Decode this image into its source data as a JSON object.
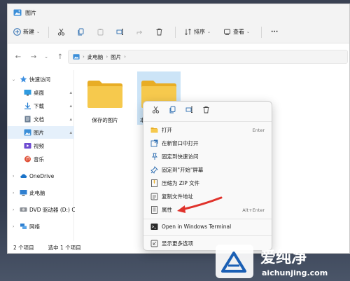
{
  "window": {
    "title": "图片"
  },
  "toolbar": {
    "new_label": "新建",
    "sort_label": "排序",
    "view_label": "查看",
    "more_label": "···"
  },
  "address": {
    "segments": [
      "此电脑",
      "图片"
    ]
  },
  "nav": {
    "items": [
      {
        "label": "快速访问",
        "icon": "star-icon"
      },
      {
        "label": "桌面",
        "icon": "desktop-icon"
      },
      {
        "label": "下载",
        "icon": "download-icon"
      },
      {
        "label": "文档",
        "icon": "document-icon"
      },
      {
        "label": "图片",
        "icon": "pictures-icon"
      },
      {
        "label": "视频",
        "icon": "video-icon"
      },
      {
        "label": "音乐",
        "icon": "music-icon"
      },
      {
        "label": "OneDrive",
        "icon": "cloud-icon"
      },
      {
        "label": "此电脑",
        "icon": "pc-icon"
      },
      {
        "label": "DVD 驱动器 (D:) CC",
        "icon": "dvd-icon"
      },
      {
        "label": "网络",
        "icon": "network-icon"
      }
    ]
  },
  "content": {
    "folders": [
      {
        "label": "保存的图片"
      },
      {
        "label": "本"
      }
    ]
  },
  "status": {
    "count": "2 个项目",
    "selected": "选中 1 个项目"
  },
  "context_menu": {
    "items": [
      {
        "label": "打开",
        "shortcut": "Enter",
        "icon": "open-icon"
      },
      {
        "label": "在新窗口中打开",
        "shortcut": "",
        "icon": "new-window-icon"
      },
      {
        "label": "固定到快速访问",
        "shortcut": "",
        "icon": "pin-icon"
      },
      {
        "label": "固定到\"开始\"屏幕",
        "shortcut": "",
        "icon": "pin-start-icon"
      },
      {
        "label": "压缩为 ZIP 文件",
        "shortcut": "",
        "icon": "zip-icon"
      },
      {
        "label": "复制文件地址",
        "shortcut": "",
        "icon": "copy-path-icon"
      },
      {
        "label": "属性",
        "shortcut": "Alt+Enter",
        "icon": "properties-icon"
      },
      {
        "label": "Open in Windows Terminal",
        "shortcut": "",
        "icon": "terminal-icon"
      },
      {
        "label": "显示更多选项",
        "shortcut": "",
        "icon": "more-options-icon"
      }
    ]
  },
  "watermark": {
    "brand": "爱纯净",
    "url": "aichunjing.com"
  },
  "colors": {
    "folder": "#f6c94d",
    "folder_dark": "#e8ad25",
    "selection": "#cce4f7",
    "accent": "#0067c0",
    "arrow": "#e0322b"
  }
}
